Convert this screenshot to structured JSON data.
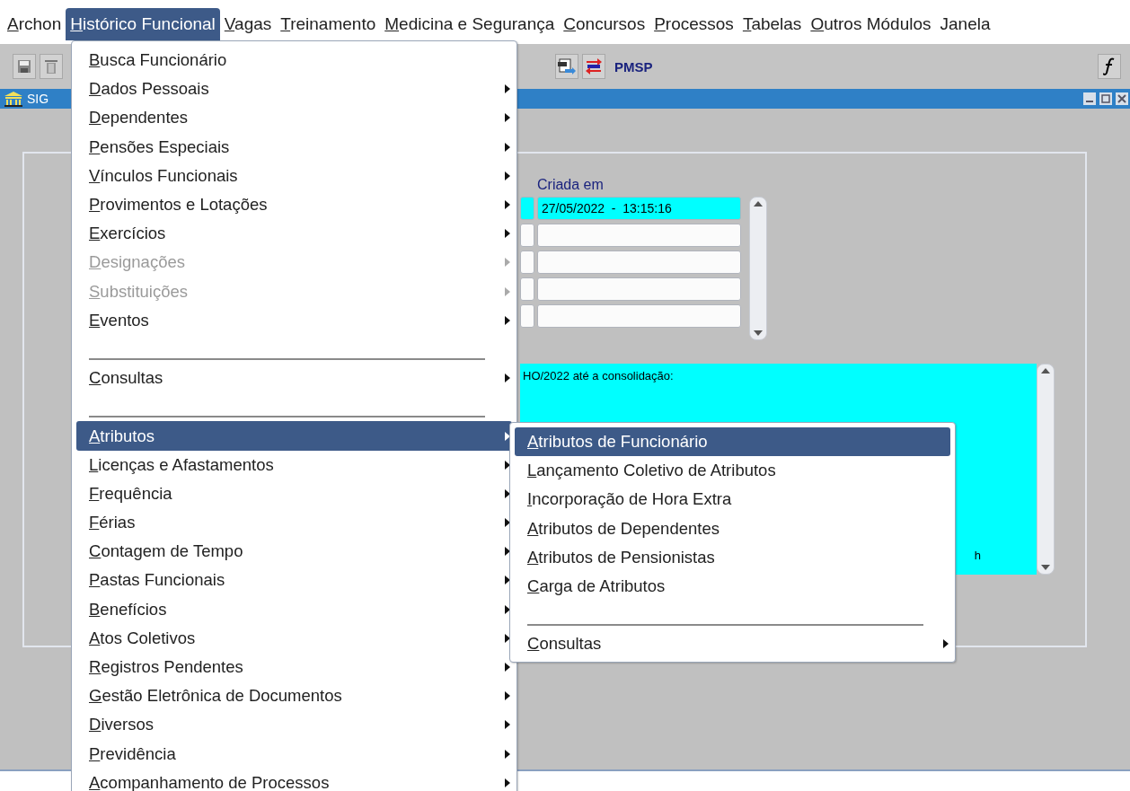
{
  "menubar": [
    {
      "label": "Archon",
      "selected": false,
      "mnemonic": true
    },
    {
      "label": "Histórico Funcional",
      "selected": true,
      "mnemonic": true
    },
    {
      "label": "Vagas",
      "selected": false,
      "mnemonic": true
    },
    {
      "label": "Treinamento",
      "selected": false,
      "mnemonic": true
    },
    {
      "label": "Medicina e Segurança",
      "selected": false,
      "mnemonic": true
    },
    {
      "label": "Concursos",
      "selected": false,
      "mnemonic": true
    },
    {
      "label": "Processos",
      "selected": false,
      "mnemonic": true
    },
    {
      "label": "Tabelas",
      "selected": false,
      "mnemonic": true
    },
    {
      "label": "Outros Módulos",
      "selected": false,
      "mnemonic": true
    },
    {
      "label": "Janela",
      "selected": false,
      "mnemonic": false
    }
  ],
  "toolbar": {
    "brand": "PMSP"
  },
  "window": {
    "title": "SIG"
  },
  "form": {
    "column_label": "Criada em",
    "rows": [
      {
        "current": true,
        "value": "27/05/2022  -  13:15:16"
      },
      {
        "current": false
      },
      {
        "current": false
      },
      {
        "current": false
      },
      {
        "current": false
      }
    ]
  },
  "note": {
    "lines": [
      "HO/2022 até a consolidação:",
      "h"
    ]
  },
  "menu": {
    "items": [
      {
        "kind": "item",
        "label": "Busca Funcionário",
        "submenu": false,
        "disabled": false,
        "selected": false
      },
      {
        "kind": "item",
        "label": "Dados Pessoais",
        "submenu": true,
        "disabled": false,
        "selected": false
      },
      {
        "kind": "item",
        "label": "Dependentes",
        "submenu": true,
        "disabled": false,
        "selected": false
      },
      {
        "kind": "item",
        "label": "Pensões Especiais",
        "submenu": true,
        "disabled": false,
        "selected": false
      },
      {
        "kind": "item",
        "label": "Vínculos Funcionais",
        "submenu": true,
        "disabled": false,
        "selected": false
      },
      {
        "kind": "item",
        "label": "Provimentos e Lotações",
        "submenu": true,
        "disabled": false,
        "selected": false
      },
      {
        "kind": "item",
        "label": "Exercícios",
        "submenu": true,
        "disabled": false,
        "selected": false
      },
      {
        "kind": "item",
        "label": "Designações",
        "submenu": true,
        "disabled": true,
        "selected": false
      },
      {
        "kind": "item",
        "label": "Substituições",
        "submenu": true,
        "disabled": true,
        "selected": false
      },
      {
        "kind": "item",
        "label": "Eventos",
        "submenu": true,
        "disabled": false,
        "selected": false
      },
      {
        "kind": "separator"
      },
      {
        "kind": "item",
        "label": "Consultas",
        "submenu": true,
        "disabled": false,
        "selected": false
      },
      {
        "kind": "separator"
      },
      {
        "kind": "item",
        "label": "Atributos",
        "submenu": true,
        "disabled": false,
        "selected": true
      },
      {
        "kind": "item",
        "label": "Licenças e Afastamentos",
        "submenu": true,
        "disabled": false,
        "selected": false
      },
      {
        "kind": "item",
        "label": "Frequência",
        "submenu": true,
        "disabled": false,
        "selected": false
      },
      {
        "kind": "item",
        "label": "Férias",
        "submenu": true,
        "disabled": false,
        "selected": false
      },
      {
        "kind": "item",
        "label": "Contagem de Tempo",
        "submenu": true,
        "disabled": false,
        "selected": false
      },
      {
        "kind": "item",
        "label": "Pastas Funcionais",
        "submenu": true,
        "disabled": false,
        "selected": false
      },
      {
        "kind": "item",
        "label": "Benefícios",
        "submenu": true,
        "disabled": false,
        "selected": false
      },
      {
        "kind": "item",
        "label": "Atos Coletivos",
        "submenu": true,
        "disabled": false,
        "selected": false
      },
      {
        "kind": "item",
        "label": "Registros Pendentes",
        "submenu": true,
        "disabled": false,
        "selected": false
      },
      {
        "kind": "item",
        "label": "Gestão Eletrônica de Documentos",
        "submenu": true,
        "disabled": false,
        "selected": false
      },
      {
        "kind": "item",
        "label": "Diversos",
        "submenu": true,
        "disabled": false,
        "selected": false
      },
      {
        "kind": "item",
        "label": "Previdência",
        "submenu": true,
        "disabled": false,
        "selected": false
      },
      {
        "kind": "item",
        "label": "Acompanhamento de Processos",
        "submenu": true,
        "disabled": false,
        "selected": false
      }
    ]
  },
  "submenu": {
    "items": [
      {
        "kind": "item",
        "label": "Atributos de Funcionário",
        "submenu": false,
        "disabled": false,
        "selected": true
      },
      {
        "kind": "item",
        "label": "Lançamento Coletivo de Atributos",
        "submenu": false,
        "disabled": false,
        "selected": false
      },
      {
        "kind": "item",
        "label": "Incorporação de Hora Extra",
        "submenu": false,
        "disabled": false,
        "selected": false
      },
      {
        "kind": "item",
        "label": "Atributos de Dependentes",
        "submenu": false,
        "disabled": false,
        "selected": false
      },
      {
        "kind": "item",
        "label": "Atributos de Pensionistas",
        "submenu": false,
        "disabled": false,
        "selected": false
      },
      {
        "kind": "item",
        "label": "Carga de Atributos",
        "submenu": false,
        "disabled": false,
        "selected": false
      },
      {
        "kind": "separator"
      },
      {
        "kind": "item",
        "label": "Consultas",
        "submenu": true,
        "disabled": false,
        "selected": false
      }
    ]
  }
}
